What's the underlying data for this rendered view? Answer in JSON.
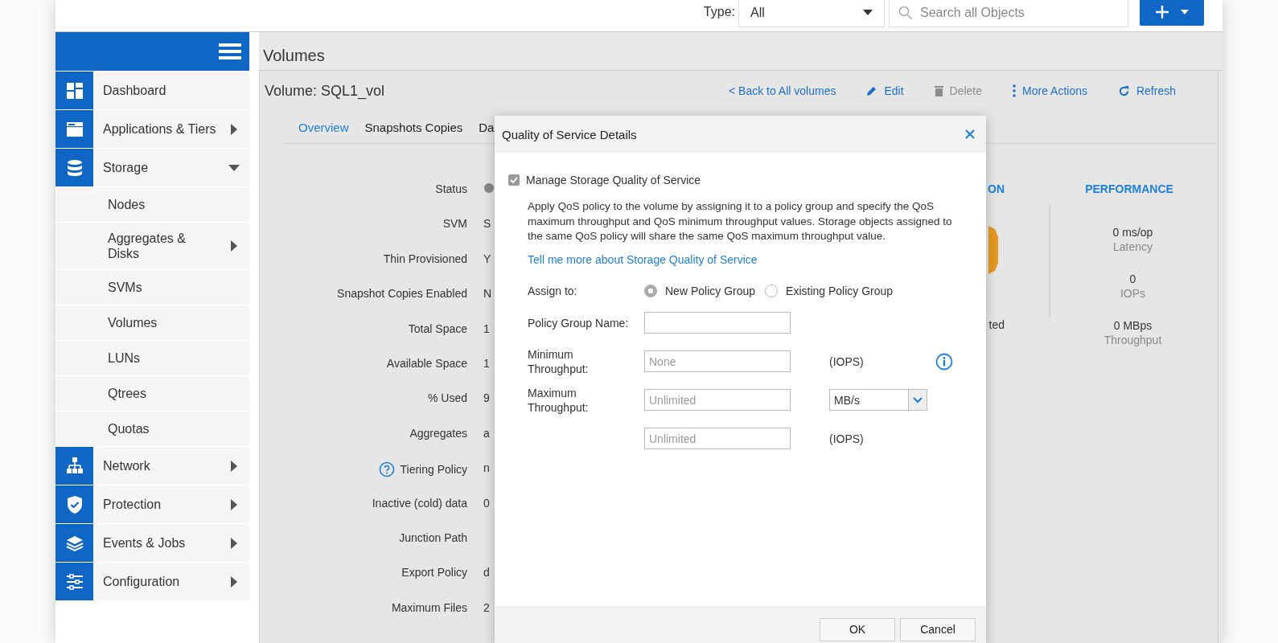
{
  "topbar": {
    "type_label": "Type:",
    "type_select": "All",
    "search": {
      "placeholder": "Search all Objects"
    }
  },
  "sidebar": {
    "items": [
      {
        "label": "Dashboard"
      },
      {
        "label": "Applications & Tiers",
        "expanded": false
      },
      {
        "label": "Storage",
        "expanded": true,
        "children": [
          {
            "label": "Nodes"
          },
          {
            "label": "Aggregates & Disks",
            "expanded": false
          },
          {
            "label": "SVMs"
          },
          {
            "label": "Volumes"
          },
          {
            "label": "LUNs"
          },
          {
            "label": "Qtrees"
          },
          {
            "label": "Quotas"
          }
        ]
      },
      {
        "label": "Network",
        "expanded": false
      },
      {
        "label": "Protection",
        "expanded": false
      },
      {
        "label": "Events & Jobs",
        "expanded": false
      },
      {
        "label": "Configuration",
        "expanded": false
      }
    ]
  },
  "page": {
    "title": "Volumes"
  },
  "volume": {
    "title": "Volume: SQL1_vol",
    "actions": [
      {
        "label": "< Back to All volumes",
        "kind": "link",
        "disabled": false
      },
      {
        "label": "Edit",
        "kind": "edit",
        "disabled": false
      },
      {
        "label": "Delete",
        "kind": "delete",
        "disabled": true
      },
      {
        "label": "More Actions",
        "kind": "more",
        "disabled": false
      },
      {
        "label": "Refresh",
        "kind": "refresh",
        "disabled": false
      }
    ],
    "tabs": [
      {
        "label": "Overview",
        "selected": true
      },
      {
        "label": "Snapshots Copies",
        "selected": false
      },
      {
        "label": "Da",
        "selected": false
      }
    ],
    "details": [
      {
        "label": "Status",
        "kind": "status"
      },
      {
        "label": "SVM",
        "kind": "text",
        "value": "S"
      },
      {
        "label": "Thin Provisioned",
        "kind": "text",
        "value": "Y"
      },
      {
        "label": "Snapshot Copies Enabled",
        "kind": "text",
        "value": "N"
      },
      {
        "label": "Total Space",
        "kind": "text",
        "value": "1"
      },
      {
        "label": "Available Space",
        "kind": "text",
        "value": "1"
      },
      {
        "label": "% Used",
        "kind": "text",
        "value": "9"
      },
      {
        "label": "Aggregates",
        "kind": "text",
        "value": "a"
      },
      {
        "label": "Tiering Policy",
        "kind": "help",
        "value": "n"
      },
      {
        "label": "Inactive (cold) data",
        "kind": "text",
        "value": "0"
      },
      {
        "label": "Junction Path",
        "kind": "text"
      },
      {
        "label": "Export Policy",
        "kind": "text",
        "value": "d"
      },
      {
        "label": "Maximum Files",
        "kind": "text",
        "value": "2"
      }
    ],
    "capacity": {
      "heading": "ON",
      "caption": "ted"
    },
    "performance": {
      "title": "PERFORMANCE",
      "metrics": [
        {
          "value": "0 ms/op",
          "label": "Latency"
        },
        {
          "value": "0",
          "label": "IOPs"
        },
        {
          "value": "0 MBps",
          "label": "Throughput"
        }
      ]
    }
  },
  "modal": {
    "title": "Quality of Service Details",
    "manage": {
      "label": "Manage Storage Quality of Service",
      "checked": true
    },
    "description": "Apply QoS policy to the volume by assigning it to a policy group and specify the QoS maximum throughput and QoS minimum throughput values. Storage objects assigned to the same QoS policy will share the same QoS maximum throughput value.",
    "link": "Tell me more about Storage Quality of Service",
    "assign": {
      "label": "Assign to:",
      "options": [
        {
          "label": "New Policy Group",
          "selected": true
        },
        {
          "label": "Existing Policy Group",
          "selected": false
        }
      ]
    },
    "fields": [
      {
        "label": "Policy Group Name:",
        "kind": "plain"
      },
      {
        "label": "Minimum Throughput:",
        "placeholder": "None",
        "kind": "unit",
        "unit": "(IOPS)",
        "info": true
      },
      {
        "label": "Maximum Throughput:",
        "placeholder": "Unlimited",
        "kind": "select",
        "unit": "MB/s"
      },
      {
        "placeholder": "Unlimited",
        "kind": "unit",
        "unit": "(IOPS)"
      }
    ],
    "buttons": [
      "OK",
      "Cancel"
    ]
  }
}
